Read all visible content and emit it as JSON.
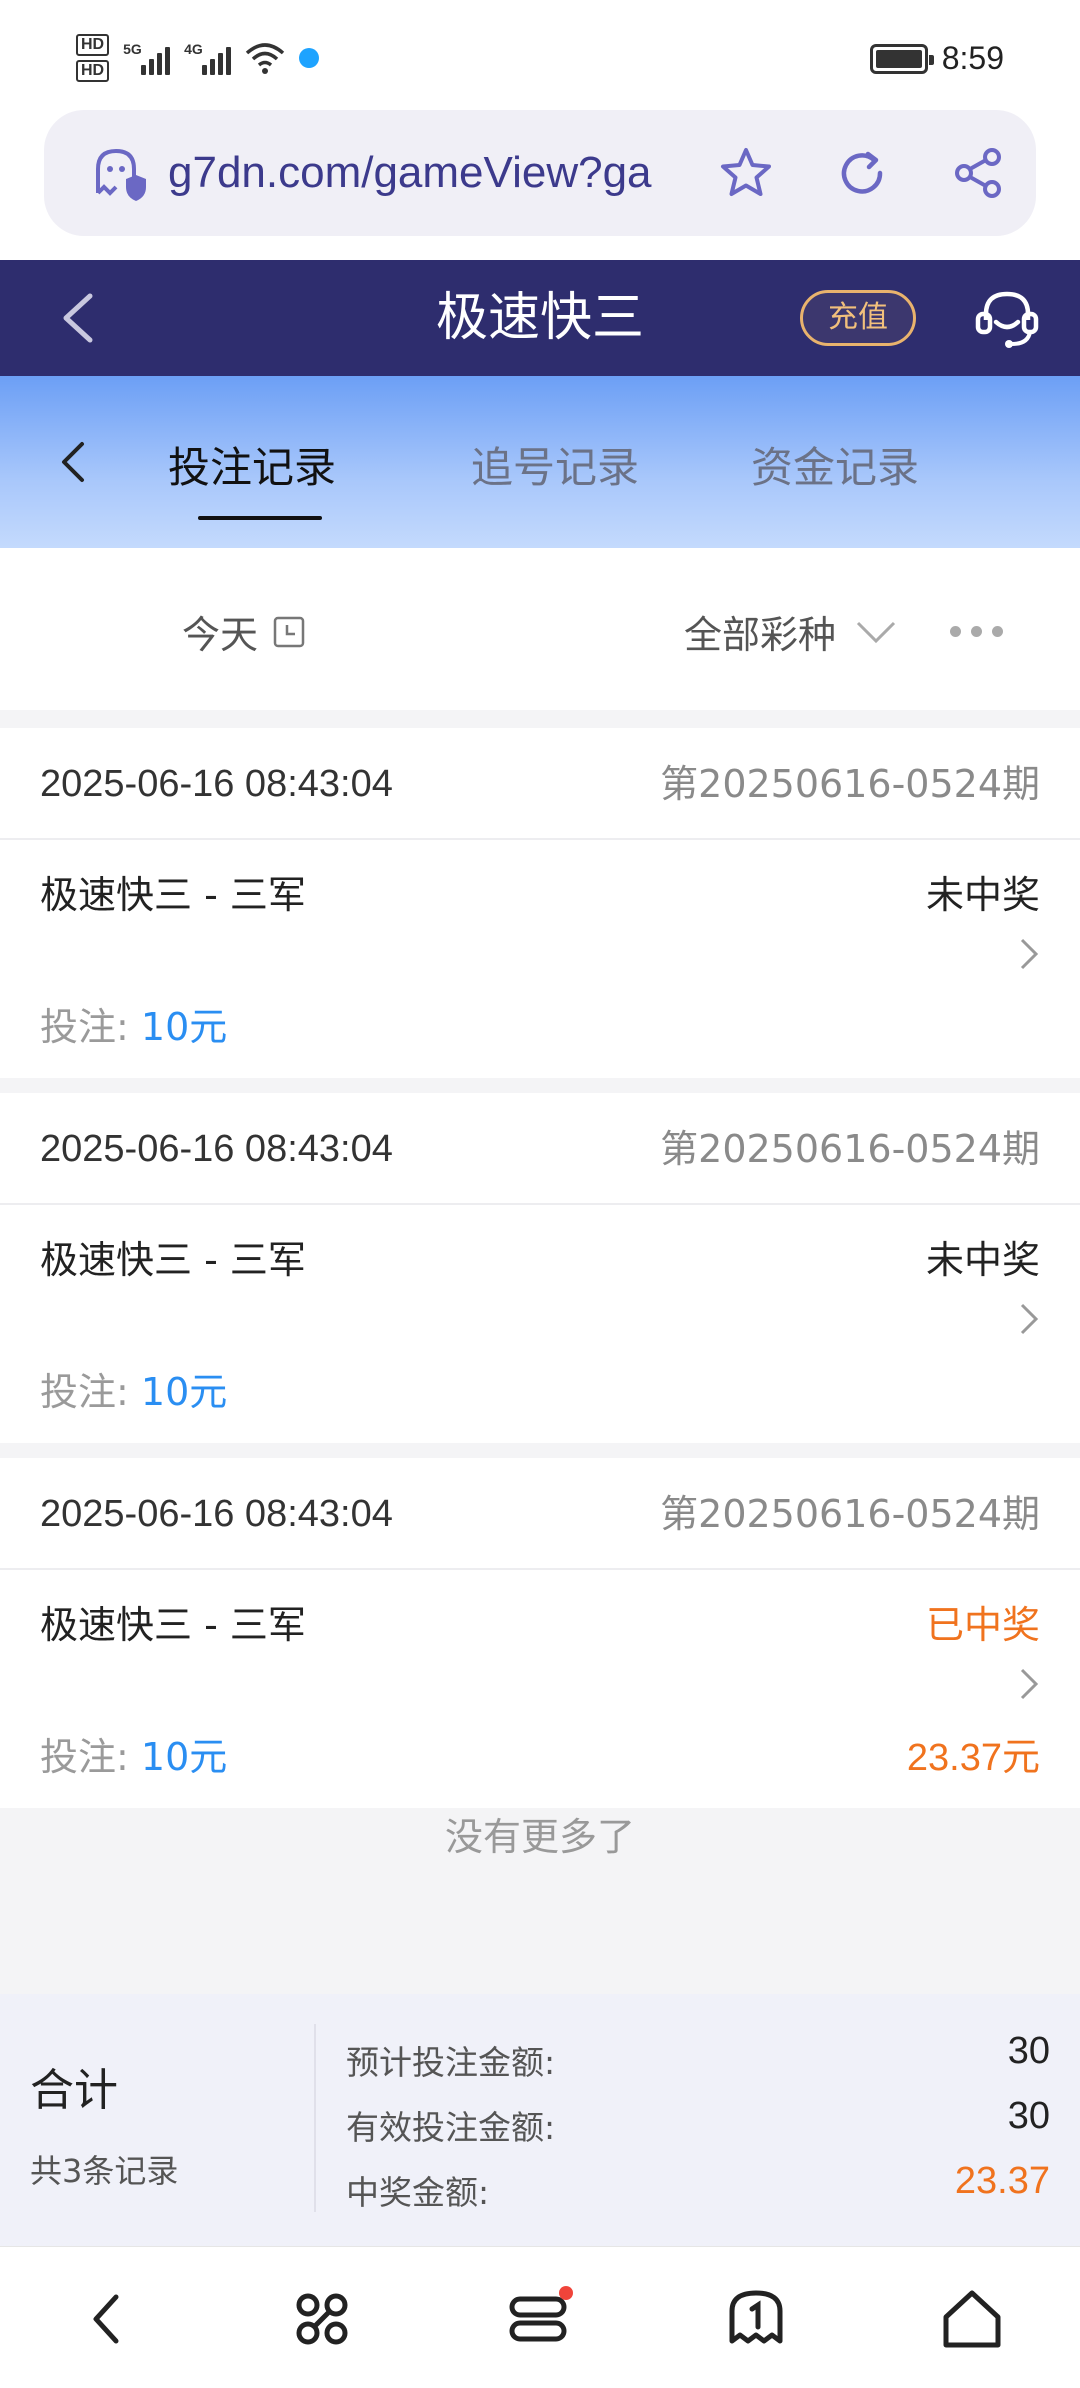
{
  "status_bar": {
    "time": "8:59",
    "sim1": "HD",
    "sim2": "HD",
    "net1": "5G",
    "net2": "4G"
  },
  "browser": {
    "url": "g7dn.com/gameView?ga"
  },
  "app_header": {
    "title": "极速快三",
    "recharge_label": "充值"
  },
  "tabs": [
    {
      "label": "投注记录",
      "active": true
    },
    {
      "label": "追号记录",
      "active": false
    },
    {
      "label": "资金记录",
      "active": false
    }
  ],
  "filter": {
    "date": "今天",
    "lottery": "全部彩种"
  },
  "records": [
    {
      "time": "2025-06-16 08:43:04",
      "issue": "第20250616-0524期",
      "name": "极速快三 - 三军",
      "status": "未中奖",
      "bet_label": "投注:",
      "bet_amount": "10元",
      "prize": ""
    },
    {
      "time": "2025-06-16 08:43:04",
      "issue": "第20250616-0524期",
      "name": "极速快三 - 三军",
      "status": "未中奖",
      "bet_label": "投注:",
      "bet_amount": "10元",
      "prize": ""
    },
    {
      "time": "2025-06-16 08:43:04",
      "issue": "第20250616-0524期",
      "name": "极速快三 - 三军",
      "status": "已中奖",
      "bet_label": "投注:",
      "bet_amount": "10元",
      "prize": "23.37元"
    }
  ],
  "no_more": "没有更多了",
  "summary": {
    "title": "合计",
    "count": "共3条记录",
    "rows": [
      {
        "label": "预计投注金额:",
        "value": "30"
      },
      {
        "label": "有效投注金额:",
        "value": "30"
      },
      {
        "label": "中奖金额:",
        "value": "23.37"
      }
    ]
  },
  "colors": {
    "header_bg": "#2e2d6e",
    "accent_blue": "#2a8ef2",
    "win_orange": "#f0731e",
    "recharge_gold": "#e9b36d"
  }
}
